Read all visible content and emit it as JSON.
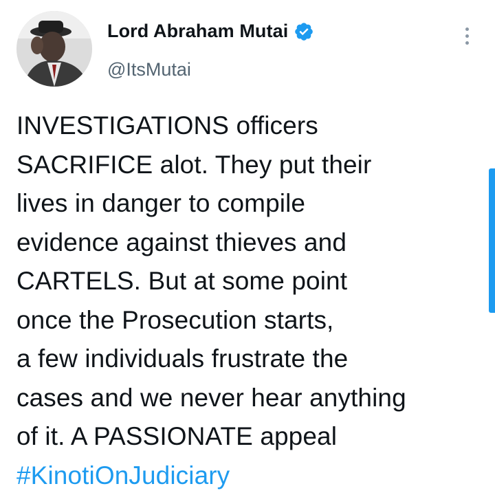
{
  "tweet": {
    "author": {
      "display_name": "Lord Abraham Mutai",
      "handle": "@ItsMutai",
      "verified": true,
      "avatar_icon": "profile-photo"
    },
    "body_lines": [
      "INVESTIGATIONS officers",
      "SACRIFICE alot. They put their",
      "lives in danger to compile",
      "evidence against thieves and",
      "CARTELS. But at some point",
      "once the Prosecution starts,",
      "a few individuals frustrate the",
      "cases and we never hear anything",
      "of it. A PASSIONATE appeal"
    ],
    "hashtag": "#KinotiOnJudiciary",
    "more_icon": "more-vertical-icon"
  },
  "colors": {
    "text": "#0f1419",
    "secondary_text": "#536471",
    "accent": "#1d9bf0",
    "background": "#ffffff"
  }
}
